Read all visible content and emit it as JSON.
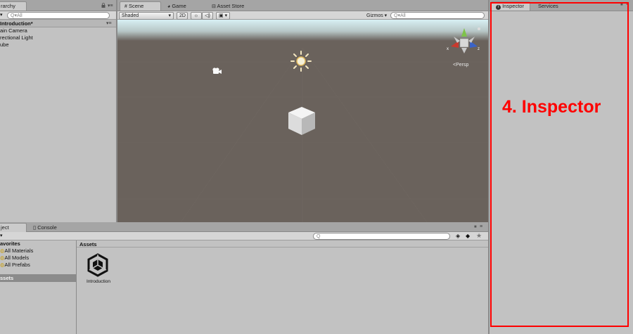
{
  "hierarchy": {
    "tab_label": "rarchy",
    "create_label": "▾",
    "search_placeholder": "Q▾All",
    "scene_name": "Introduction*",
    "items": [
      {
        "label": "ain Camera"
      },
      {
        "label": "rectional Light"
      },
      {
        "label": "ube"
      }
    ]
  },
  "scene_view": {
    "tabs": [
      {
        "label": "Scene"
      },
      {
        "label": "Game"
      },
      {
        "label": "Asset Store"
      }
    ],
    "shading_mode": "Shaded",
    "btn_2d": "2D",
    "gizmos_label": "Gizmos",
    "search_placeholder": "Q▾All",
    "persp_label": "Persp",
    "axis_x": "x",
    "axis_z": "z"
  },
  "project": {
    "tabs": [
      {
        "label": "ject"
      },
      {
        "label": "Console"
      }
    ],
    "favorites_label": "avorites",
    "favorites": [
      {
        "label": "All Materials"
      },
      {
        "label": "All Models"
      },
      {
        "label": "All Prefabs"
      }
    ],
    "assets_sidebar_label": "ssets",
    "assets_header": "Assets",
    "asset_items": [
      {
        "label": "Introduction"
      }
    ]
  },
  "inspector": {
    "tabs": [
      {
        "label": "Inspector"
      },
      {
        "label": "Services"
      }
    ],
    "annotation": "4. Inspector",
    "annotation_color": "#ff0000"
  },
  "colors": {
    "scene_ground": "#6a625c",
    "scene_sky": "#d7eef2",
    "selection": "#8b8b8b"
  }
}
